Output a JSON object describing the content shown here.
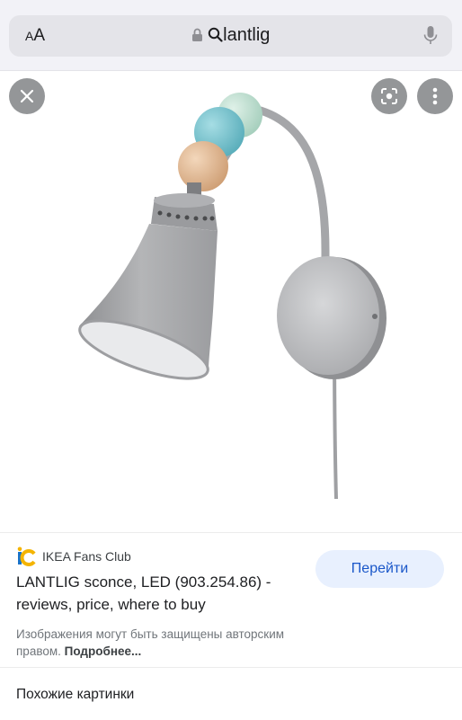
{
  "browser": {
    "text_size_label": "AA",
    "url": "lantlig"
  },
  "viewer": {
    "image_alt": "LANTLIG sconce lamp",
    "colors": {
      "lamp_grey": "#a9aaac",
      "bead_mint": "#bfe0d0",
      "bead_teal": "#79c3cf",
      "bead_wood": "#e8c29f"
    }
  },
  "result": {
    "source_name": "IKEA Fans Club",
    "title": "LANTLIG sconce, LED (903.254.86) - reviews, price, where to buy",
    "visit_label": "Перейти",
    "notice_text": "Изображения могут быть защищены авторским правом.",
    "notice_more": "Подробнее...",
    "similar_label": "Похожие картинки"
  }
}
